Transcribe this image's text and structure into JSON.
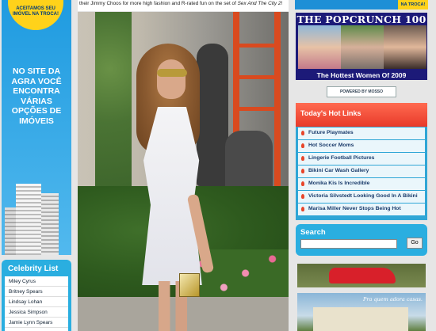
{
  "left_ad": {
    "seal_text": "ACEITAMOS SEU IMÓVEL NA TROCA!",
    "headline": "NO SITE DA AGRA VOCÊ ENCONTRA VÁRIAS OPÇÕES DE IMÓVEIS"
  },
  "celebrity_list": {
    "title": "Celebrity List",
    "items": [
      "Miley Cyrus",
      "Britney Spears",
      "Lindsay Lohan",
      "Jessica Simpson",
      "Jamie Lynn Spears"
    ]
  },
  "article": {
    "text_before": "their Jimmy Choos for more high fashion and R-rated fun on the set of ",
    "title_italic": "Sex And The City 2",
    "text_after": "!"
  },
  "right": {
    "top_ad_badge": "NA TROCA!",
    "popcrunch_title": "THE POPCRUNCH 100",
    "popcrunch_subtitle": "The Hottest Women Of 2009",
    "powered_by": "POWERED BY MOSSO",
    "hot_links_title": "Today's Hot Links",
    "hot_links": [
      "Future Playmates",
      "Hot Soccer Moms",
      "Lingerie Football Pictures",
      "Bikini Car Wash Gallery",
      "Monika Kis Is Incredible",
      "Victoria Silvstedt Looking Good In A Bikini",
      "Marisa Miller Never Stops Being Hot"
    ],
    "search_label": "Search",
    "search_placeholder": "",
    "search_button": "Go",
    "house_ad_tag": "Pra quem adora casas."
  }
}
